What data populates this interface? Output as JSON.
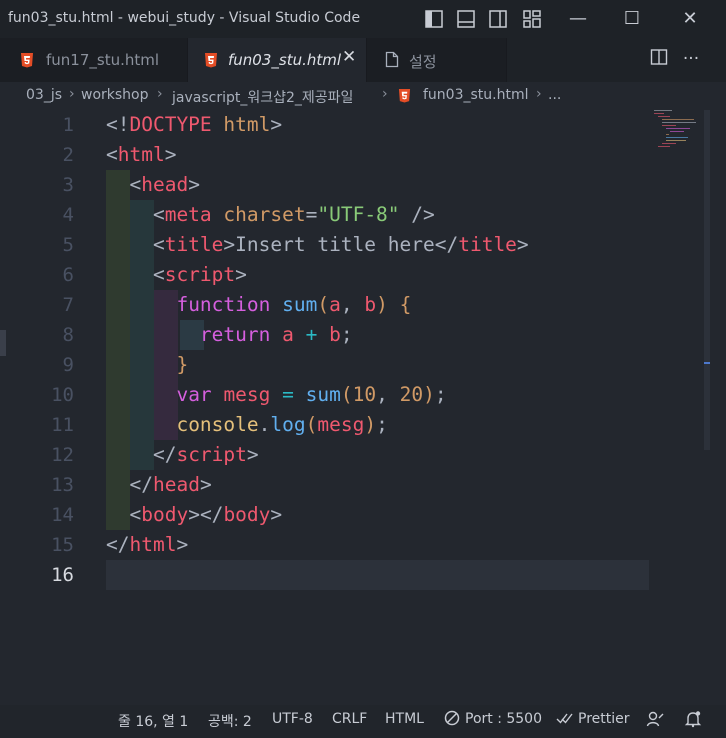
{
  "window": {
    "title": "fun03_stu.html - webui_study - Visual Studio Code",
    "controls": {
      "minimize": "—",
      "maximize": "☐",
      "close": "✕"
    }
  },
  "tabs": [
    {
      "label": "fun17_stu.html",
      "icon": "html5-icon",
      "active": false
    },
    {
      "label": "fun03_stu.html",
      "icon": "html5-icon",
      "active": true,
      "close": "✕"
    },
    {
      "label": "설정",
      "icon": "file-icon",
      "active": false
    }
  ],
  "tabbar_actions": {
    "more": "···"
  },
  "breadcrumb": {
    "items": [
      "03_js",
      "workshop",
      "javascript_워크샵2_제공파일",
      "fun03_stu.html",
      "..."
    ],
    "separator": "›"
  },
  "editor": {
    "active_line": 16,
    "line_numbers": [
      "1",
      "2",
      "3",
      "4",
      "5",
      "6",
      "7",
      "8",
      "9",
      "10",
      "11",
      "12",
      "13",
      "14",
      "15",
      "16"
    ],
    "lines": [
      [
        {
          "t": "<!",
          "c": "txt"
        },
        {
          "t": "DOCTYPE",
          "c": "tag"
        },
        {
          "t": " ",
          "c": "txt"
        },
        {
          "t": "html",
          "c": "attr"
        },
        {
          "t": ">",
          "c": "txt"
        }
      ],
      [
        {
          "t": "<",
          "c": "txt"
        },
        {
          "t": "html",
          "c": "tag"
        },
        {
          "t": ">",
          "c": "txt"
        }
      ],
      [
        {
          "t": "  <",
          "c": "txt"
        },
        {
          "t": "head",
          "c": "tag"
        },
        {
          "t": ">",
          "c": "txt"
        }
      ],
      [
        {
          "t": "    <",
          "c": "txt"
        },
        {
          "t": "meta",
          "c": "tag"
        },
        {
          "t": " ",
          "c": "txt"
        },
        {
          "t": "charset",
          "c": "attr"
        },
        {
          "t": "=",
          "c": "txt"
        },
        {
          "t": "\"UTF-8\"",
          "c": "str"
        },
        {
          "t": " />",
          "c": "txt"
        }
      ],
      [
        {
          "t": "    <",
          "c": "txt"
        },
        {
          "t": "title",
          "c": "tag"
        },
        {
          "t": ">Insert title here</",
          "c": "txt"
        },
        {
          "t": "title",
          "c": "tag"
        },
        {
          "t": ">",
          "c": "txt"
        }
      ],
      [
        {
          "t": "    <",
          "c": "txt"
        },
        {
          "t": "script",
          "c": "tag"
        },
        {
          "t": ">",
          "c": "txt"
        }
      ],
      [
        {
          "t": "      ",
          "c": "txt"
        },
        {
          "t": "function",
          "c": "kw"
        },
        {
          "t": " ",
          "c": "txt"
        },
        {
          "t": "sum",
          "c": "fn"
        },
        {
          "t": "(",
          "c": "br1"
        },
        {
          "t": "a",
          "c": "var"
        },
        {
          "t": ", ",
          "c": "txt"
        },
        {
          "t": "b",
          "c": "var"
        },
        {
          "t": ")",
          "c": "br1"
        },
        {
          "t": " ",
          "c": "txt"
        },
        {
          "t": "{",
          "c": "br1"
        }
      ],
      [
        {
          "t": "        ",
          "c": "txt"
        },
        {
          "t": "return",
          "c": "kw"
        },
        {
          "t": " ",
          "c": "txt"
        },
        {
          "t": "a",
          "c": "var"
        },
        {
          "t": " ",
          "c": "txt"
        },
        {
          "t": "+",
          "c": "op"
        },
        {
          "t": " ",
          "c": "txt"
        },
        {
          "t": "b",
          "c": "var"
        },
        {
          "t": ";",
          "c": "txt"
        }
      ],
      [
        {
          "t": "      ",
          "c": "txt"
        },
        {
          "t": "}",
          "c": "br1"
        }
      ],
      [
        {
          "t": "      ",
          "c": "txt"
        },
        {
          "t": "var",
          "c": "kw"
        },
        {
          "t": " ",
          "c": "txt"
        },
        {
          "t": "mesg",
          "c": "var"
        },
        {
          "t": " ",
          "c": "txt"
        },
        {
          "t": "=",
          "c": "op"
        },
        {
          "t": " ",
          "c": "txt"
        },
        {
          "t": "sum",
          "c": "fn"
        },
        {
          "t": "(",
          "c": "br1"
        },
        {
          "t": "10",
          "c": "num"
        },
        {
          "t": ", ",
          "c": "txt"
        },
        {
          "t": "20",
          "c": "num"
        },
        {
          "t": ")",
          "c": "br1"
        },
        {
          "t": ";",
          "c": "txt"
        }
      ],
      [
        {
          "t": "      ",
          "c": "txt"
        },
        {
          "t": "console",
          "c": "obj"
        },
        {
          "t": ".",
          "c": "txt"
        },
        {
          "t": "log",
          "c": "fn"
        },
        {
          "t": "(",
          "c": "br1"
        },
        {
          "t": "mesg",
          "c": "var"
        },
        {
          "t": ")",
          "c": "br1"
        },
        {
          "t": ";",
          "c": "txt"
        }
      ],
      [
        {
          "t": "    </",
          "c": "txt"
        },
        {
          "t": "script",
          "c": "tag"
        },
        {
          "t": ">",
          "c": "txt"
        }
      ],
      [
        {
          "t": "  </",
          "c": "txt"
        },
        {
          "t": "head",
          "c": "tag"
        },
        {
          "t": ">",
          "c": "txt"
        }
      ],
      [
        {
          "t": "  <",
          "c": "txt"
        },
        {
          "t": "body",
          "c": "tag"
        },
        {
          "t": "></",
          "c": "txt"
        },
        {
          "t": "body",
          "c": "tag"
        },
        {
          "t": ">",
          "c": "txt"
        }
      ],
      [
        {
          "t": "</",
          "c": "txt"
        },
        {
          "t": "html",
          "c": "tag"
        },
        {
          "t": ">",
          "c": "txt"
        }
      ],
      []
    ]
  },
  "statusbar": {
    "position": "줄 16, 열 1",
    "spaces": "공백: 2",
    "encoding": "UTF-8",
    "eol": "CRLF",
    "language": "HTML",
    "port": "Port : 5500",
    "prettier": "Prettier"
  },
  "colors": {
    "editor_bg": "#23272e",
    "titlebar_bg": "#1e2227",
    "tag": "#ef596f",
    "keyword": "#d55fde",
    "function": "#61afef",
    "string": "#89ca78",
    "number": "#d19a66"
  }
}
